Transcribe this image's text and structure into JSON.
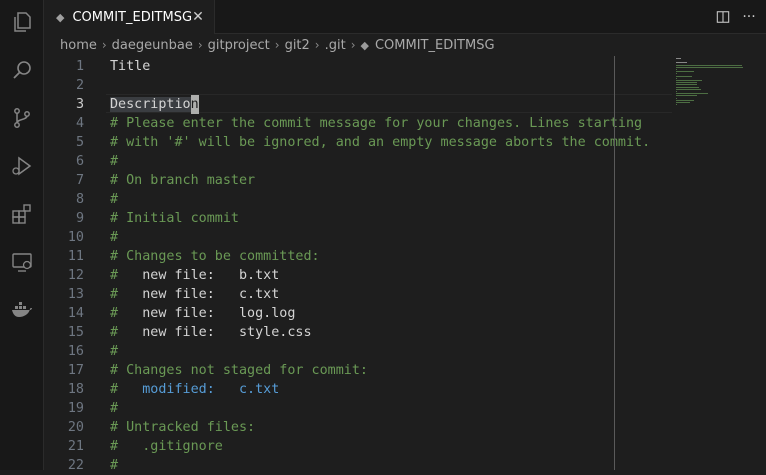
{
  "activity_bar": {
    "items": [
      {
        "name": "explorer",
        "icon": "files-icon"
      },
      {
        "name": "search",
        "icon": "search-icon"
      },
      {
        "name": "source-control",
        "icon": "source-control-icon"
      },
      {
        "name": "run-debug",
        "icon": "debug-icon"
      },
      {
        "name": "extensions",
        "icon": "extensions-icon"
      },
      {
        "name": "remote-explorer",
        "icon": "remote-icon"
      },
      {
        "name": "docker",
        "icon": "docker-icon"
      }
    ]
  },
  "tab": {
    "title": "COMMIT_EDITMSG",
    "close_glyph": "✕"
  },
  "tab_tools": {
    "split": "split-editor-icon",
    "more": "···"
  },
  "breadcrumbs": [
    "home",
    "daegeunbae",
    "gitproject",
    "git2",
    ".git",
    "COMMIT_EDITMSG"
  ],
  "editor": {
    "active_line": 3,
    "lines": [
      {
        "n": "1",
        "text": "Title",
        "kind": "plain"
      },
      {
        "n": "2",
        "text": "",
        "kind": "plain"
      },
      {
        "n": "3",
        "text": "Descriptio",
        "cursor_char": "n",
        "kind": "current"
      },
      {
        "n": "4",
        "text": "# Please enter the commit message for your changes. Lines starting",
        "kind": "comment"
      },
      {
        "n": "5",
        "text": "# with '#' will be ignored, and an empty message aborts the commit.",
        "kind": "comment"
      },
      {
        "n": "6",
        "text": "#",
        "kind": "comment"
      },
      {
        "n": "7",
        "text": "# On branch master",
        "kind": "comment"
      },
      {
        "n": "8",
        "text": "#",
        "kind": "comment"
      },
      {
        "n": "9",
        "text": "# Initial commit",
        "kind": "comment"
      },
      {
        "n": "10",
        "text": "#",
        "kind": "comment"
      },
      {
        "n": "11",
        "text": "# Changes to be committed:",
        "kind": "comment"
      },
      {
        "n": "12",
        "prefix": "#   ",
        "label": "new file:",
        "gap": "   ",
        "file": "b.txt",
        "kind": "entry"
      },
      {
        "n": "13",
        "prefix": "#   ",
        "label": "new file:",
        "gap": "   ",
        "file": "c.txt",
        "kind": "entry"
      },
      {
        "n": "14",
        "prefix": "#   ",
        "label": "new file:",
        "gap": "   ",
        "file": "log.log",
        "kind": "entry"
      },
      {
        "n": "15",
        "prefix": "#   ",
        "label": "new file:",
        "gap": "   ",
        "file": "style.css",
        "kind": "entry"
      },
      {
        "n": "16",
        "text": "#",
        "kind": "comment"
      },
      {
        "n": "17",
        "text": "# Changes not staged for commit:",
        "kind": "comment"
      },
      {
        "n": "18",
        "prefix": "#   ",
        "label": "modified:",
        "gap": "   ",
        "file": "c.txt",
        "kind": "modified"
      },
      {
        "n": "19",
        "text": "#",
        "kind": "comment"
      },
      {
        "n": "20",
        "text": "# Untracked files:",
        "kind": "comment"
      },
      {
        "n": "21",
        "text": "#   .gitignore",
        "kind": "comment"
      },
      {
        "n": "22",
        "text": "#",
        "kind": "comment"
      }
    ]
  },
  "colors": {
    "comment": "#6a9955",
    "keyword": "#569cd6",
    "text": "#d4d4d4",
    "background": "#1e1e1e"
  }
}
